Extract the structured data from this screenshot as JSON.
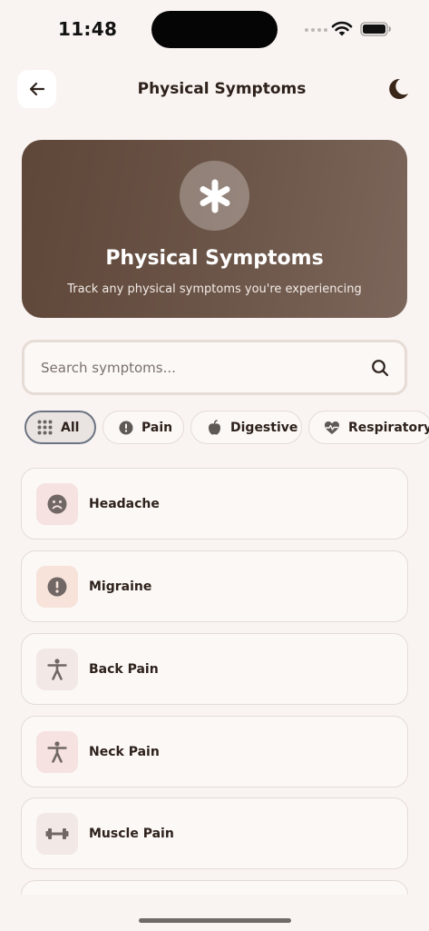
{
  "status_bar": {
    "time": "11:48"
  },
  "header": {
    "title": "Physical Symptoms",
    "back_icon": "arrow-left-icon",
    "theme_icon": "moon-icon"
  },
  "hero": {
    "icon": "asterisk-icon",
    "title": "Physical Symptoms",
    "subtitle": "Track any physical symptoms you're experiencing",
    "gradient": [
      "#5e4638",
      "#7c665b"
    ]
  },
  "search": {
    "placeholder": "Search symptoms...",
    "value": "",
    "icon": "search-icon"
  },
  "filters": [
    {
      "label": "All",
      "icon": "grid-icon",
      "active": true
    },
    {
      "label": "Pain",
      "icon": "alert-circle-icon",
      "active": false
    },
    {
      "label": "Digestive",
      "icon": "apple-icon",
      "active": false
    },
    {
      "label": "Respiratory",
      "icon": "heart-pulse-icon",
      "active": false
    }
  ],
  "symptoms": [
    {
      "label": "Headache",
      "icon": "sad-face-icon"
    },
    {
      "label": "Migraine",
      "icon": "alert-circle-icon"
    },
    {
      "label": "Back Pain",
      "icon": "person-icon"
    },
    {
      "label": "Neck Pain",
      "icon": "person-icon"
    },
    {
      "label": "Muscle Pain",
      "icon": "dumbbell-icon"
    }
  ],
  "colors": {
    "background": "#f9f4f2",
    "text": "#2e211b",
    "accent": "#5e4638",
    "icon_grey": "#716866"
  }
}
